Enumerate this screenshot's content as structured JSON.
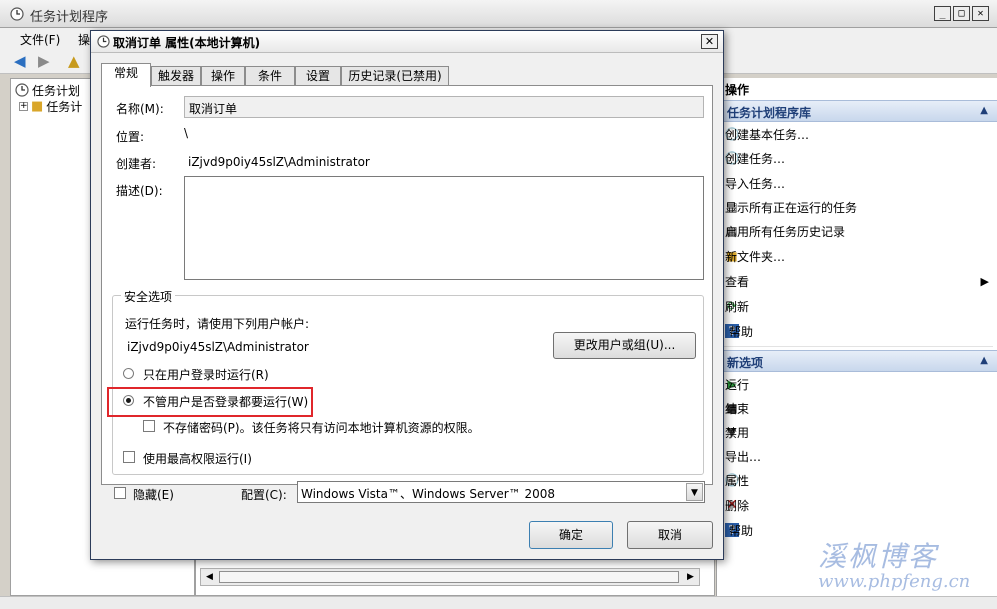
{
  "main": {
    "title": "任务计划程序",
    "menu": [
      "文件(F)",
      "操"
    ],
    "tree": [
      "任务计划",
      "任务计"
    ]
  },
  "actions": {
    "title": "操作",
    "library_header": "任务计划程序库",
    "library_items": [
      {
        "label": "创建基本任务…",
        "icon": "create-basic-task-icon"
      },
      {
        "label": "创建任务…",
        "icon": "create-task-icon"
      },
      {
        "label": "导入任务…",
        "icon": ""
      },
      {
        "label": "显示所有正在运行的任务",
        "icon": "running-tasks-icon"
      },
      {
        "label": "启用所有任务历史记录",
        "icon": "history-icon"
      },
      {
        "label": "新文件夹…",
        "icon": "folder-icon"
      },
      {
        "label": "查看",
        "icon": ""
      },
      {
        "label": "刷新",
        "icon": "refresh-icon"
      },
      {
        "label": "帮助",
        "icon": "help-icon"
      }
    ],
    "selected_header": "新选项",
    "selected_items": [
      {
        "label": "运行",
        "icon": "run-icon"
      },
      {
        "label": "结束",
        "icon": "stop-icon"
      },
      {
        "label": "禁用",
        "icon": "disable-icon"
      },
      {
        "label": "导出…",
        "icon": ""
      },
      {
        "label": "属性",
        "icon": "properties-icon"
      },
      {
        "label": "删除",
        "icon": "delete-icon"
      },
      {
        "label": "帮助",
        "icon": "help-icon"
      }
    ]
  },
  "dialog": {
    "title": "取消订单 属性(本地计算机)",
    "close": "✕",
    "tabs": [
      "常规",
      "触发器",
      "操作",
      "条件",
      "设置",
      "历史记录(已禁用)"
    ],
    "active_tab": 0,
    "name_label": "名称(M):",
    "name_value": "取消订单",
    "location_label": "位置:",
    "location_value": "\\",
    "author_label": "创建者:",
    "author_value": "iZjvd9p0iy45slZ\\Administrator",
    "description_label": "描述(D):",
    "security": {
      "title": "安全选项",
      "run_as_text": "运行任务时，请使用下列用户帐户:",
      "account": "iZjvd9p0iy45slZ\\Administrator",
      "change_button": "更改用户或组(U)...",
      "option_logged_on": "只在用户登录时运行(R)",
      "option_whether_logged": "不管用户是否登录都要运行(W)",
      "selected_option": "option_whether_logged",
      "no_store_password": "不存储密码(P)。该任务将只有访问本地计算机资源的权限。",
      "highest_privileges": "使用最高权限运行(I)"
    },
    "hidden_label": "隐藏(E)",
    "configure_label": "配置(C):",
    "configure_value": "Windows Vista™、Windows Server™ 2008",
    "ok_button": "确定",
    "cancel_button": "取消"
  },
  "watermark": {
    "cn": "溪枫博客",
    "en": "www.phpfeng.cn"
  },
  "colors": {
    "highlight": "#e0262b",
    "action_header": "#c8d7ec"
  }
}
